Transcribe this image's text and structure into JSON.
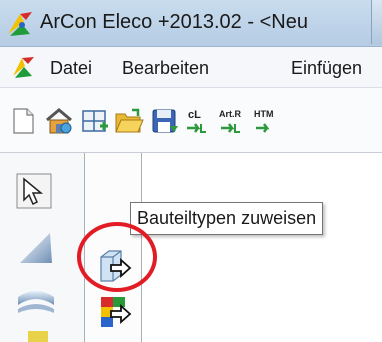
{
  "window": {
    "title": "ArCon Eleco  +2013.02 - <Neu"
  },
  "menubar": {
    "items": [
      {
        "label": "Datei"
      },
      {
        "label": "Bearbeiten"
      },
      {
        "label": "Einfügen"
      }
    ]
  },
  "toolbar": {
    "buttons": [
      {
        "icon": "new-document-icon"
      },
      {
        "icon": "house-design-icon"
      },
      {
        "icon": "floor-plan-icon"
      },
      {
        "icon": "open-folder-icon"
      },
      {
        "icon": "save-icon"
      },
      {
        "icon": "cl-export-icon",
        "label": "cL"
      },
      {
        "icon": "article-export-icon",
        "label": "Art.R"
      },
      {
        "icon": "html-export-icon",
        "label": "HTM"
      }
    ]
  },
  "tooltip": {
    "text": "Bauteiltypen zuweisen"
  },
  "colors": {
    "titlebar": "#c3d7ec",
    "highlight": "#e21c25",
    "tooltip_border": "#767676"
  }
}
